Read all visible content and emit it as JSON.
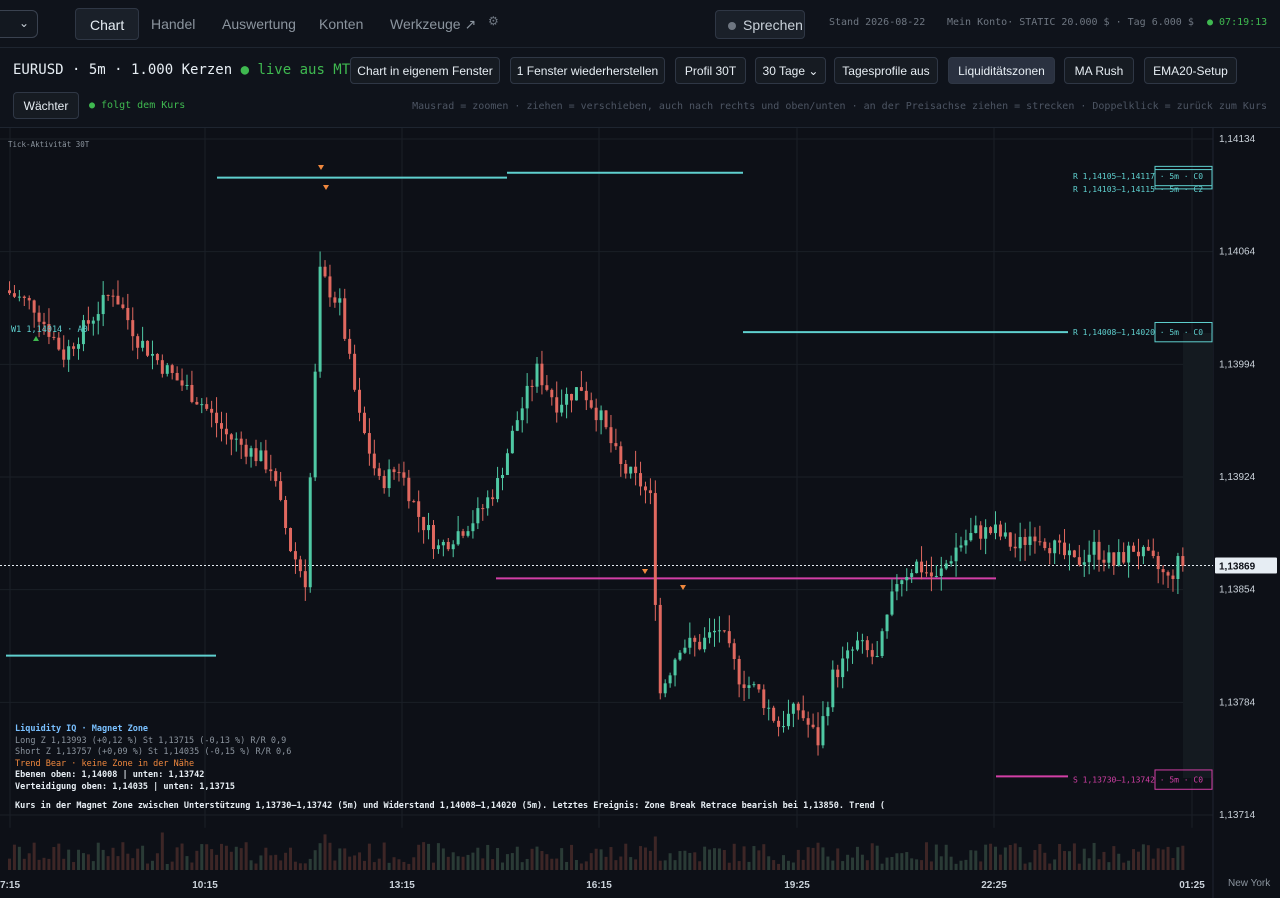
{
  "nav": {
    "tabs": [
      {
        "label": "Chart",
        "active": true
      },
      {
        "label": "Handel",
        "active": false
      },
      {
        "label": "Auswertung",
        "active": false
      },
      {
        "label": "Konten",
        "active": false
      },
      {
        "label": "Werkzeuge ↗",
        "active": false
      }
    ],
    "speak_label": "Sprechen",
    "stand": "Stand 2026-08-22",
    "account": "Mein Konto· STATIC 20.000 $ · Tag 6.000 $",
    "clock": "● 07:19:13"
  },
  "toolbar": {
    "symbol": "EURUSD · 5m · 1.000 Kerzen",
    "live": "● live aus MT5",
    "buttons": [
      "Chart in eigenem Fenster",
      "1 Fenster wiederherstellen",
      "Profil 30T",
      "30 Tage",
      "Tagesprofile aus",
      "Liquiditätszonen",
      "MA Rush",
      "EMA20-Setup"
    ],
    "watcher": "Wächter",
    "follows": "● folgt dem Kurs",
    "hint": "Mausrad = zoomen · ziehen = verschieben, auch nach rechts und oben/unten · an der Preisachse ziehen = strecken · Doppelklick = zurück zum Kurs"
  },
  "overlay": {
    "tick_activity": "Tick-Aktivität 30T",
    "w1_label": "W1 1,14014 · A0",
    "zones": {
      "r1": "R 1,14105–1,14117 · 5m · C0",
      "r2": "R 1,14103–1,14115 · 5m · C2",
      "r3": "R 1,14008–1,14020 · 5m · C0",
      "s1": "S 1,13730–1,13742 · 5m · C0"
    },
    "current_price": "1,13869"
  },
  "panel": {
    "title": "Liquidity IQ · Magnet Zone",
    "long": "Long  Z 1,13993 (+0,12 %)  St 1,13715 (-0,13 %)  R/R 0,9",
    "short": "Short Z 1,13757 (+0,09 %)  St 1,14035 (-0,15 %)  R/R 0,6",
    "trend": "Trend Bear · keine Zone in der Nähe",
    "levels": "Ebenen oben: 1,14008 | unten: 1,13742",
    "defense": "Verteidigung oben: 1,14035 | unten: 1,13715",
    "summary": "Kurs in der Magnet Zone zwischen Unterstützung 1,13730–1,13742 (5m) und Widerstand 1,14008–1,14020 (5m). Letztes Ereignis: Zone Break Retrace bearish bei 1,13850. Trend ("
  },
  "timezone": "New York",
  "colors": {
    "up": "#4fc9a4",
    "down": "#e0685f",
    "resistance": "#5fd0cf",
    "support": "#d23fa6"
  },
  "chart_data": {
    "type": "candlestick",
    "symbol": "EURUSD",
    "timeframe": "5m",
    "y_ticks": [
      1.14134,
      1.14064,
      1.13994,
      1.13924,
      1.13854,
      1.13784,
      1.13714
    ],
    "y_tick_labels": [
      "1,14134",
      "1,14064",
      "1,13994",
      "1,13924",
      "1,13854",
      "1,13784",
      "1,13714"
    ],
    "ylim": [
      1.13706,
      1.1414
    ],
    "x_ticks": [
      "7:15",
      "10:15",
      "13:15",
      "16:15",
      "19:25",
      "22:25",
      "01:25"
    ],
    "current_price": 1.13869,
    "anchors": [
      [
        0,
        1.1404
      ],
      [
        6,
        1.1403
      ],
      [
        12,
        1.14
      ],
      [
        17,
        1.1402
      ],
      [
        22,
        1.1404
      ],
      [
        27,
        1.1401
      ],
      [
        33,
        1.1399
      ],
      [
        40,
        1.1397
      ],
      [
        45,
        1.1395
      ],
      [
        50,
        1.1394
      ],
      [
        54,
        1.1393
      ],
      [
        58,
        1.1388
      ],
      [
        61,
        1.1386
      ],
      [
        64,
        1.1405
      ],
      [
        68,
        1.1403
      ],
      [
        72,
        1.1396
      ],
      [
        76,
        1.1392
      ],
      [
        80,
        1.1393
      ],
      [
        84,
        1.139
      ],
      [
        88,
        1.1388
      ],
      [
        92,
        1.1389
      ],
      [
        96,
        1.139
      ],
      [
        100,
        1.1392
      ],
      [
        104,
        1.1396
      ],
      [
        108,
        1.1399
      ],
      [
        112,
        1.1397
      ],
      [
        117,
        1.1398
      ],
      [
        121,
        1.1396
      ],
      [
        125,
        1.1393
      ],
      [
        129,
        1.1392
      ],
      [
        131,
        1.1391
      ],
      [
        133,
        1.1379
      ],
      [
        137,
        1.1382
      ],
      [
        141,
        1.1382
      ],
      [
        145,
        1.1383
      ],
      [
        149,
        1.138
      ],
      [
        153,
        1.1379
      ],
      [
        157,
        1.1377
      ],
      [
        161,
        1.1378
      ],
      [
        165,
        1.1376
      ],
      [
        168,
        1.138
      ],
      [
        173,
        1.1382
      ],
      [
        177,
        1.1381
      ],
      [
        181,
        1.1386
      ],
      [
        185,
        1.1387
      ],
      [
        189,
        1.1386
      ],
      [
        193,
        1.1388
      ],
      [
        197,
        1.1389
      ],
      [
        201,
        1.1389
      ],
      [
        205,
        1.1388
      ],
      [
        209,
        1.1389
      ],
      [
        213,
        1.1388
      ],
      [
        217,
        1.1387
      ],
      [
        221,
        1.1388
      ],
      [
        225,
        1.1387
      ],
      [
        229,
        1.1388
      ],
      [
        233,
        1.1387
      ],
      [
        236,
        1.1386
      ],
      [
        238,
        1.1387
      ]
    ],
    "candle_count": 239,
    "resistance_zones": [
      {
        "from": 1.14105,
        "to": 1.14117,
        "label": "R 1,14105–1,14117 · 5m · C0"
      },
      {
        "from": 1.14103,
        "to": 1.14115,
        "label": "R 1,14103–1,14115 · 5m · C2"
      },
      {
        "from": 1.14008,
        "to": 1.1402,
        "label": "R 1,14008–1,14020 · 5m · C0"
      }
    ],
    "support_zones": [
      {
        "from": 1.1373,
        "to": 1.13742,
        "label": "S 1,13730–1,13742 · 5m · C0"
      }
    ],
    "levels": {
      "upper": 1.14008,
      "lower": 1.13742,
      "defense_upper": 1.14035,
      "defense_lower": 1.13715,
      "retrace": 1.1385
    }
  }
}
